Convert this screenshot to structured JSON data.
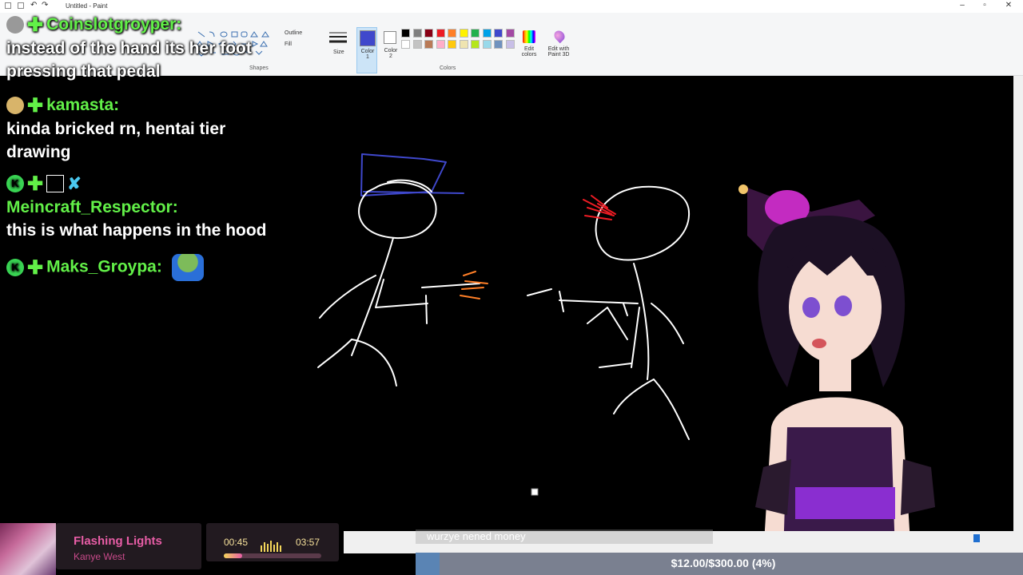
{
  "app": {
    "window_title": "Untitled - Paint",
    "ribbon": {
      "size_label": "Size",
      "color1_label": "Color 1",
      "color2_label": "Color 2",
      "edit_colors_label": "Edit colors",
      "edit_paint3d_label": "Edit with Paint 3D",
      "outline_label": "Outline",
      "fill_label": "Fill",
      "group_shapes": "Shapes",
      "group_colors": "Colors"
    },
    "palette_row1": [
      "#000000",
      "#7f7f7f",
      "#880015",
      "#ed1c24",
      "#ff7f27",
      "#fff200",
      "#22b14c",
      "#00a2e8",
      "#3f48cc",
      "#a349a4"
    ],
    "palette_row2": [
      "#ffffff",
      "#c3c3c3",
      "#b97a57",
      "#ffaec9",
      "#ffc90e",
      "#efe4b0",
      "#b5e61d",
      "#99d9ea",
      "#7092be",
      "#c8bfe7"
    ],
    "color1": "#3f48cc",
    "color2": "#ffffff"
  },
  "chat": [
    {
      "user": "Coinslotgroyper:",
      "message_lines": [
        "instead of the hand its her foot",
        "pressing that pedal"
      ]
    },
    {
      "user": "kamasta:",
      "message_lines": [
        "kinda bricked rn, hentai tier",
        "drawing"
      ]
    },
    {
      "user": "Meincraft_Respector:",
      "message_lines": [
        "this is what happens in the hood"
      ]
    },
    {
      "user": "Maks_Groypa:",
      "message_lines": []
    }
  ],
  "music": {
    "song": "Flashing Lights",
    "artist": "Kanye West",
    "elapsed": "00:45",
    "total": "03:57",
    "progress": 0.19
  },
  "donation": {
    "message": "wurzye nened money",
    "goal_text": "$12.00/$300.00 (4%)",
    "goal_fraction": 0.04
  }
}
